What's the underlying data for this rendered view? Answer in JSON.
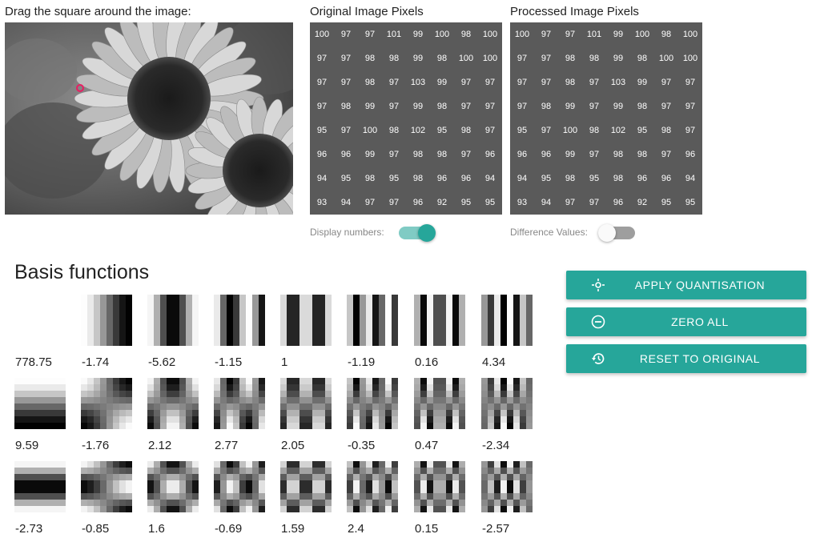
{
  "image_section": {
    "instruction": "Drag the square around the image:"
  },
  "original": {
    "title": "Original Image Pixels",
    "pixels": [
      [
        100,
        97,
        97,
        101,
        99,
        100,
        98,
        100
      ],
      [
        97,
        97,
        98,
        98,
        99,
        98,
        100,
        100
      ],
      [
        97,
        97,
        98,
        97,
        103,
        99,
        97,
        97
      ],
      [
        97,
        98,
        99,
        97,
        99,
        98,
        97,
        97
      ],
      [
        95,
        97,
        100,
        98,
        102,
        95,
        98,
        97
      ],
      [
        96,
        96,
        99,
        97,
        98,
        98,
        97,
        96
      ],
      [
        94,
        95,
        98,
        95,
        98,
        96,
        96,
        94
      ],
      [
        93,
        94,
        97,
        97,
        96,
        92,
        95,
        95
      ]
    ]
  },
  "processed": {
    "title": "Processed Image Pixels",
    "pixels": [
      [
        100,
        97,
        97,
        101,
        99,
        100,
        98,
        100
      ],
      [
        97,
        97,
        98,
        98,
        99,
        98,
        100,
        100
      ],
      [
        97,
        97,
        98,
        97,
        103,
        99,
        97,
        97
      ],
      [
        97,
        98,
        99,
        97,
        99,
        98,
        97,
        97
      ],
      [
        95,
        97,
        100,
        98,
        102,
        95,
        98,
        97
      ],
      [
        96,
        96,
        99,
        97,
        98,
        98,
        97,
        96
      ],
      [
        94,
        95,
        98,
        95,
        98,
        96,
        96,
        94
      ],
      [
        93,
        94,
        97,
        97,
        96,
        92,
        95,
        95
      ]
    ]
  },
  "toggles": {
    "display_numbers": {
      "label": "Display numbers:",
      "on": true
    },
    "difference_values": {
      "label": "Difference Values:",
      "on": false
    }
  },
  "basis": {
    "title": "Basis functions",
    "coefficients": [
      [
        "778.75",
        "-1.74",
        "-5.62",
        "-1.15",
        "1",
        "-1.19",
        "0.16",
        "4.34"
      ],
      [
        "9.59",
        "-1.76",
        "2.12",
        "2.77",
        "2.05",
        "-0.35",
        "0.47",
        "-2.34"
      ],
      [
        "-2.73",
        "-0.85",
        "1.6",
        "-0.69",
        "1.59",
        "2.4",
        "0.15",
        "-2.57"
      ]
    ]
  },
  "buttons": {
    "apply": {
      "label": "APPLY QUANTISATION",
      "icon": "quantise-icon"
    },
    "zero": {
      "label": "ZERO ALL",
      "icon": "minus-circle-icon"
    },
    "reset": {
      "label": "RESET TO ORIGINAL",
      "icon": "history-icon"
    }
  },
  "colors": {
    "accent": "#26a69a",
    "accent_light": "#80cbc4",
    "grid_bg": "#5a5a5a",
    "marker": "#e91e63"
  }
}
